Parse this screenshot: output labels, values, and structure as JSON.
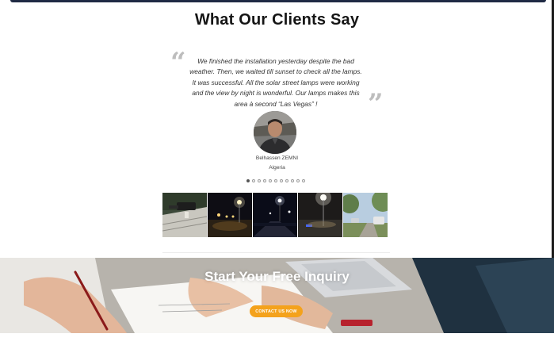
{
  "testimonials": {
    "heading": "What Our Clients Say",
    "quote": "We finished the installation yesterday despite the bad weather. Then, we waited till sunset to check all the lamps. It was successful. All the solar street lamps were working and the view by night is wonderful. Our lamps makes this area à second “Las Vegas” !",
    "client_name": "Belhassen ZEMNI",
    "client_country": "Algeria",
    "slide_count": 11,
    "active_slide": 1
  },
  "gallery": {
    "images": [
      "street-lamp-closeup-photo",
      "lamps-at-night-field-photo",
      "night-road-lamps-photo",
      "lamp-at-night-parking-photo",
      "daytime-street-trees-photo"
    ]
  },
  "cta": {
    "title": "Start Your Free Inquiry",
    "button_label": "CONTACT US NOW"
  },
  "colors": {
    "accent": "#f4a21c",
    "top_bar": "#1f2a44"
  }
}
